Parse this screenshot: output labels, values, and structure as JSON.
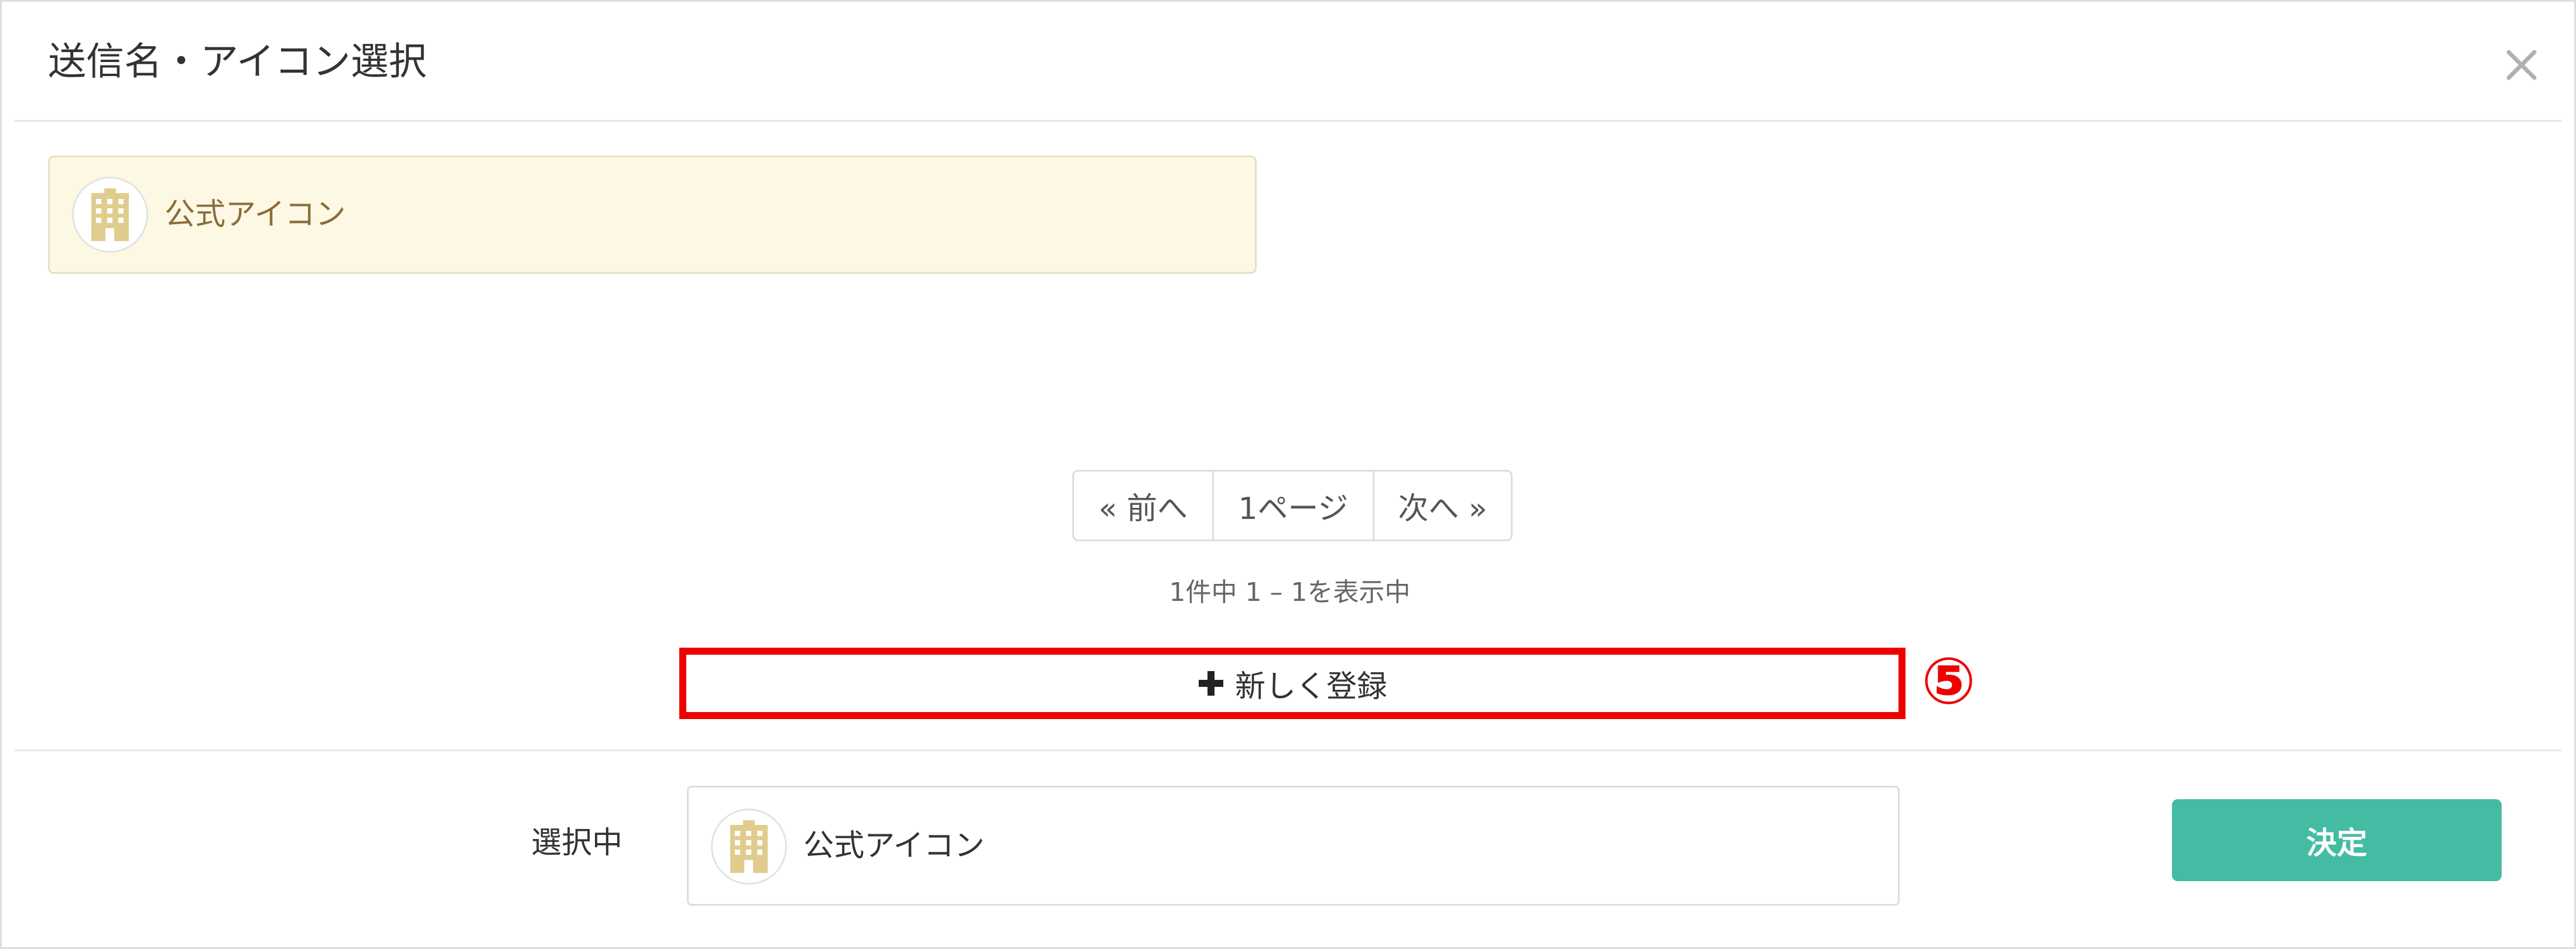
{
  "dialog": {
    "title": "送信名・アイコン選択",
    "close_icon": "close-icon"
  },
  "options": [
    {
      "label": "公式アイコン",
      "icon": "building-icon",
      "selected": true
    }
  ],
  "pagination": {
    "prev_label": "« 前へ",
    "page_label": "1ページ",
    "next_label": "次へ »",
    "summary": "1件中 1 – 1を表示中"
  },
  "actions": {
    "new_label": "新しく登録",
    "new_icon": "plus-icon",
    "annotation_marker": "⑤"
  },
  "footer": {
    "selected_label": "選択中",
    "selected_value": "公式アイコン",
    "selected_icon": "building-icon",
    "submit_label": "決定"
  },
  "colors": {
    "accent": "#43bca3",
    "highlight_bg": "#fcf8e3",
    "highlight_text": "#8a6d3b",
    "annotation": "#ee0000",
    "icon_tan": "#e0cd8e"
  }
}
